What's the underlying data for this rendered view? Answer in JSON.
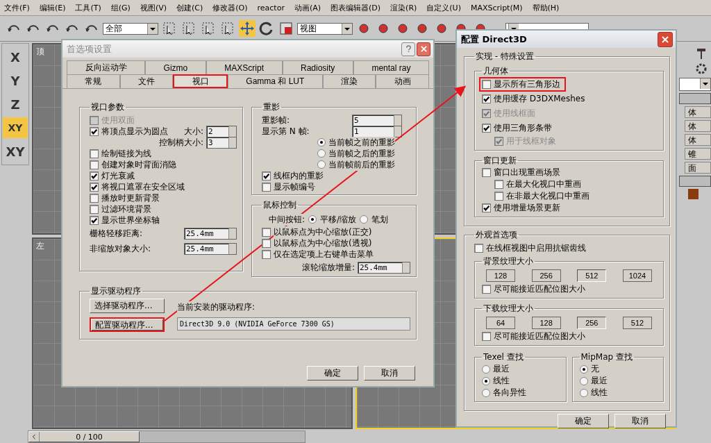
{
  "menu": [
    "文件(F)",
    "编辑(E)",
    "工具(T)",
    "组(G)",
    "视图(V)",
    "创建(C)",
    "修改器(O)",
    "reactor",
    "动画(A)",
    "图表编辑器(D)",
    "渲染(R)",
    "自定义(U)",
    "MAXScript(M)",
    "帮助(H)"
  ],
  "toolbar": {
    "selection_filter": "全部",
    "reference_coord": "视图"
  },
  "axis_buttons": [
    {
      "label": "X",
      "selected": false
    },
    {
      "label": "Y",
      "selected": false
    },
    {
      "label": "Z",
      "selected": false
    },
    {
      "label": "XY",
      "selected": true
    },
    {
      "label": "XY",
      "selected": false
    }
  ],
  "viewports": [
    {
      "label": "顶",
      "active": false
    },
    {
      "active": false
    },
    {
      "label": "左",
      "active": false
    },
    {
      "active": true
    }
  ],
  "timeline": {
    "position": "0 / 100",
    "level": 0
  },
  "command_panel": {
    "items": [
      "体",
      "体",
      "体",
      "锥",
      "面"
    ]
  },
  "preferences": {
    "title": "首选项设置",
    "tab_rows": [
      {
        "tabs": [
          {
            "label": "反向运动学",
            "selected": false,
            "highlighted": false
          },
          {
            "label": "Gizmo",
            "selected": false,
            "highlighted": false
          },
          {
            "label": "MAXScript",
            "selected": false,
            "highlighted": false
          },
          {
            "label": "Radiosity",
            "selected": false,
            "highlighted": false
          },
          {
            "label": "mental ray",
            "selected": false,
            "highlighted": false
          }
        ]
      },
      {
        "tabs": [
          {
            "label": "常规",
            "selected": false,
            "highlighted": false
          },
          {
            "label": "文件",
            "selected": false,
            "highlighted": false
          },
          {
            "label": "视口",
            "selected": true,
            "highlighted": true
          },
          {
            "label": "Gamma 和 LUT",
            "selected": false,
            "highlighted": false
          },
          {
            "label": "渲染",
            "selected": false,
            "highlighted": false
          },
          {
            "label": "动画",
            "selected": false,
            "highlighted": false
          }
        ]
      }
    ],
    "viewport_params": {
      "title": "视口参数",
      "items": [
        {
          "kind": "checkbox",
          "label": "使用双面",
          "checked": false,
          "disabled": true
        },
        {
          "kind": "checkbox_spinner",
          "label": "将顶点显示为圆点",
          "checked": true,
          "disabled": false,
          "spinner_label": "大小:",
          "value": "2"
        },
        {
          "kind": "spinner_right",
          "label": "控制柄大小:",
          "value": "3"
        },
        {
          "kind": "checkbox",
          "label": "绘制链接为线",
          "checked": false,
          "disabled": false
        },
        {
          "kind": "checkbox",
          "label": "创建对象时背面消隐",
          "checked": false,
          "disabled": false
        },
        {
          "kind": "checkbox",
          "label": "灯光衰减",
          "checked": true,
          "disabled": false
        },
        {
          "kind": "checkbox",
          "label": "将视口遮罩在安全区域",
          "checked": true,
          "disabled": false
        },
        {
          "kind": "checkbox",
          "label": "播放时更新背景",
          "checked": false,
          "disabled": false
        },
        {
          "kind": "checkbox",
          "label": "过滤环境背景",
          "checked": false,
          "disabled": false
        },
        {
          "kind": "checkbox",
          "label": "显示世界坐标轴",
          "checked": true,
          "disabled": false
        },
        {
          "kind": "spinner",
          "label": "栅格轻移距离:",
          "value": "25.4mm"
        },
        {
          "kind": "spinner",
          "label": "非缩放对象大小:",
          "value": "25.4mm"
        }
      ]
    },
    "ghosting": {
      "title": "重影",
      "items": [
        {
          "kind": "spinner",
          "label": "重影帧:",
          "value": "5"
        },
        {
          "kind": "spinner",
          "label": "显示第 N 帧:",
          "value": "1"
        },
        {
          "kind": "radio",
          "label": "当前帧之前的重影",
          "selected": true
        },
        {
          "kind": "radio",
          "label": "当前帧之后的重影",
          "selected": false
        },
        {
          "kind": "radio",
          "label": "当前帧前后的重影",
          "selected": false
        },
        {
          "kind": "checkbox",
          "label": "线框内的重影",
          "checked": true,
          "disabled": false
        },
        {
          "kind": "checkbox",
          "label": "显示帧编号",
          "checked": false,
          "disabled": false
        }
      ]
    },
    "mouse_control": {
      "title": "鼠标控制",
      "items": [
        {
          "kind": "radio_row",
          "label": "中间按钮:",
          "options": [
            {
              "label": "平移/缩放",
              "selected": true
            },
            {
              "label": "笔划",
              "selected": false
            }
          ]
        },
        {
          "kind": "checkbox",
          "label": "以鼠标点为中心缩放(正交)",
          "checked": false,
          "disabled": false
        },
        {
          "kind": "checkbox",
          "label": "以鼠标点为中心缩放(透视)",
          "checked": false,
          "disabled": false
        },
        {
          "kind": "checkbox",
          "label": "仅在选定项上右键单击菜单",
          "checked": false,
          "disabled": false
        },
        {
          "kind": "spinner_right",
          "label": "滚轮缩放增量:",
          "value": "25.4mm"
        }
      ]
    },
    "display_driver": {
      "title": "显示驱动程序",
      "buttons": [
        {
          "label": "选择驱动程序...",
          "highlighted": false
        },
        {
          "label": "配置驱动程序...",
          "highlighted": true
        }
      ],
      "current_label": "当前安装的驱动程序:",
      "current_value": "Direct3D 9.0 (NVIDIA GeForce 7300 GS)"
    },
    "buttons": [
      "确定",
      "取消"
    ]
  },
  "direct3d": {
    "title": "配置 Direct3D",
    "section_title": "实现 - 特殊设置",
    "geometry": {
      "title": "几何体",
      "items": [
        {
          "label": "显示所有三角形边",
          "checked": false,
          "disabled": false,
          "highlighted": true
        },
        {
          "label": "使用缓存 D3DXMeshes",
          "checked": true,
          "disabled": false,
          "highlighted": false
        },
        {
          "label": "使用线框面",
          "checked": true,
          "disabled": true,
          "highlighted": false
        },
        {
          "label": "使用三角形条带",
          "checked": true,
          "disabled": false,
          "highlighted": false,
          "children": [
            {
              "label": "用于线框对象",
              "checked": true,
              "disabled": true
            }
          ]
        }
      ]
    },
    "window_update": {
      "title": "窗口更新",
      "items": [
        {
          "label": "窗口出现重画场景",
          "checked": false,
          "disabled": false,
          "children": [
            {
              "label": "在最大化视口中重画",
              "checked": false,
              "disabled": false
            },
            {
              "label": "在非最大化视口中重画",
              "checked": false,
              "disabled": false
            }
          ]
        },
        {
          "label": "使用增量场景更新",
          "checked": true,
          "disabled": false
        }
      ]
    },
    "appearance": {
      "title": "外观首选项",
      "antialias": {
        "label": "在线框视图中启用抗锯齿线",
        "checked": false
      },
      "textures": [
        {
          "title": "背景纹理大小",
          "sizes": [
            {
              "label": "128",
              "selected": false
            },
            {
              "label": "256",
              "selected": false
            },
            {
              "label": "512",
              "selected": true
            },
            {
              "label": "1024",
              "selected": false
            }
          ],
          "match": {
            "label": "尽可能接近匹配位图大小",
            "checked": false
          }
        },
        {
          "title": "下载纹理大小",
          "sizes": [
            {
              "label": "64",
              "selected": false
            },
            {
              "label": "128",
              "selected": false
            },
            {
              "label": "256",
              "selected": true
            },
            {
              "label": "512",
              "selected": false
            }
          ],
          "match": {
            "label": "尽可能接近匹配位图大小",
            "checked": false
          }
        }
      ],
      "lookups": [
        {
          "title": "Texel 查找",
          "options": [
            {
              "label": "最近",
              "selected": false
            },
            {
              "label": "线性",
              "selected": true
            },
            {
              "label": "各向异性",
              "selected": false
            }
          ]
        },
        {
          "title": "MipMap 查找",
          "options": [
            {
              "label": "无",
              "selected": true
            },
            {
              "label": "最近",
              "selected": false
            },
            {
              "label": "线性",
              "selected": false
            }
          ]
        }
      ]
    },
    "buttons": [
      "确定",
      "取消"
    ]
  }
}
